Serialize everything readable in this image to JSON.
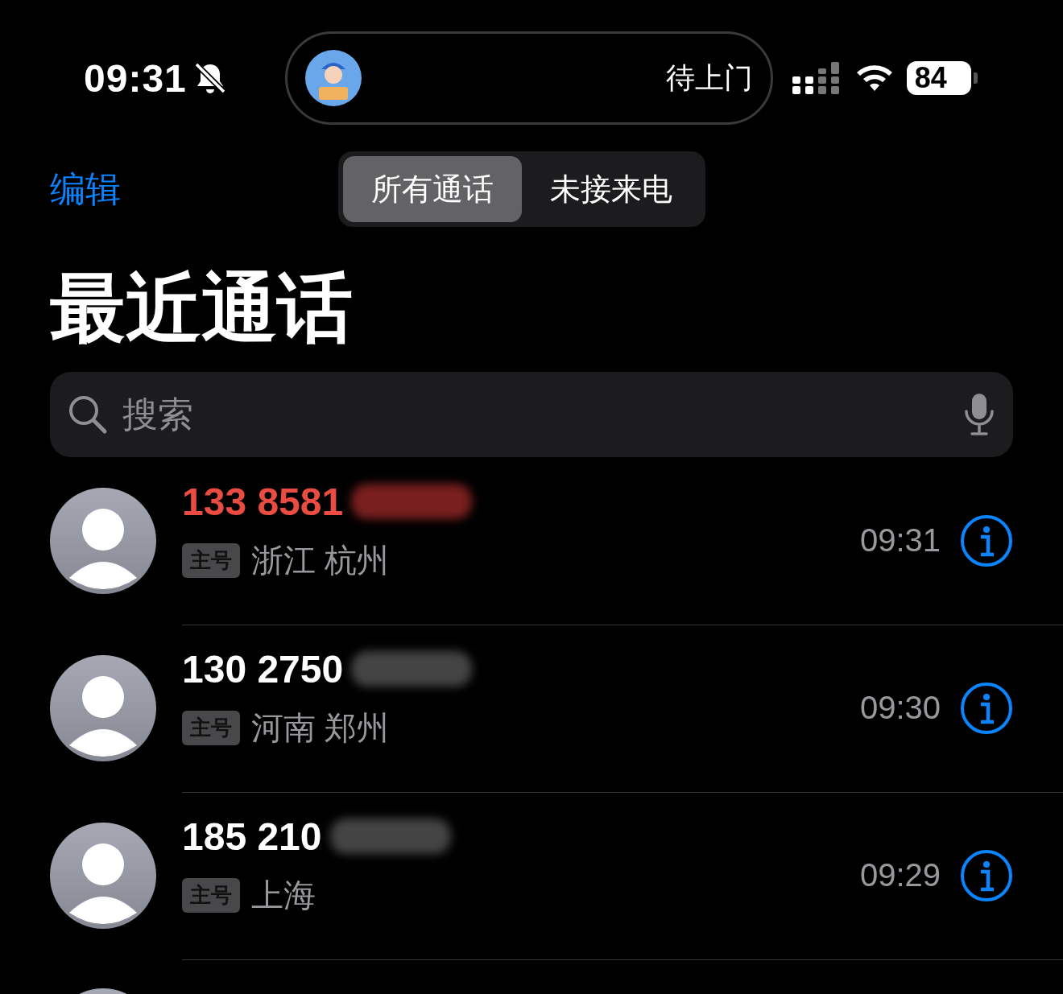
{
  "status_bar": {
    "time": "09:31",
    "silent": true,
    "activity": {
      "label": "待上门"
    },
    "battery": "84"
  },
  "nav": {
    "edit": "编辑",
    "segments": [
      {
        "label": "所有通话",
        "selected": true
      },
      {
        "label": "未接来电",
        "selected": false
      }
    ]
  },
  "title": "最近通话",
  "search": {
    "placeholder": "搜索"
  },
  "calls": [
    {
      "kind": "call",
      "number": "133 8581",
      "redacted": true,
      "missed": true,
      "tag": "主号",
      "location": "浙江 杭州",
      "time": "09:31"
    },
    {
      "kind": "call",
      "number": "130 2750",
      "redacted": true,
      "missed": false,
      "tag": "主号",
      "location": "河南 郑州",
      "time": "09:30"
    },
    {
      "kind": "call",
      "number": "185 210",
      "redacted": true,
      "missed": false,
      "tag": "主号",
      "location": "上海",
      "time": "09:29"
    },
    {
      "kind": "partial"
    }
  ]
}
